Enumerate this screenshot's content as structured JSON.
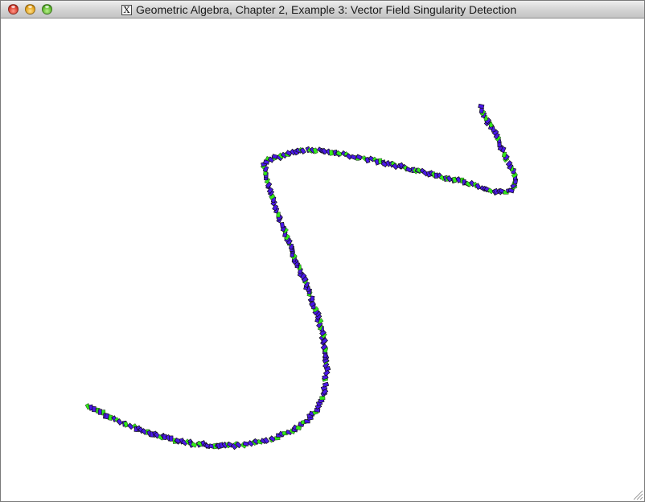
{
  "window": {
    "title": "Geometric Algebra, Chapter 2, Example 3: Vector Field Singularity Detection",
    "app_icon_glyph": "X",
    "app_icon_name": "x11-icon",
    "buttons": [
      "close-button",
      "minimize-button",
      "zoom-button"
    ]
  },
  "scene": {
    "background": "#ffffff",
    "colors": {
      "primary": "#4a18e8",
      "secondary": "#32e81a",
      "outline": "#101010"
    }
  }
}
